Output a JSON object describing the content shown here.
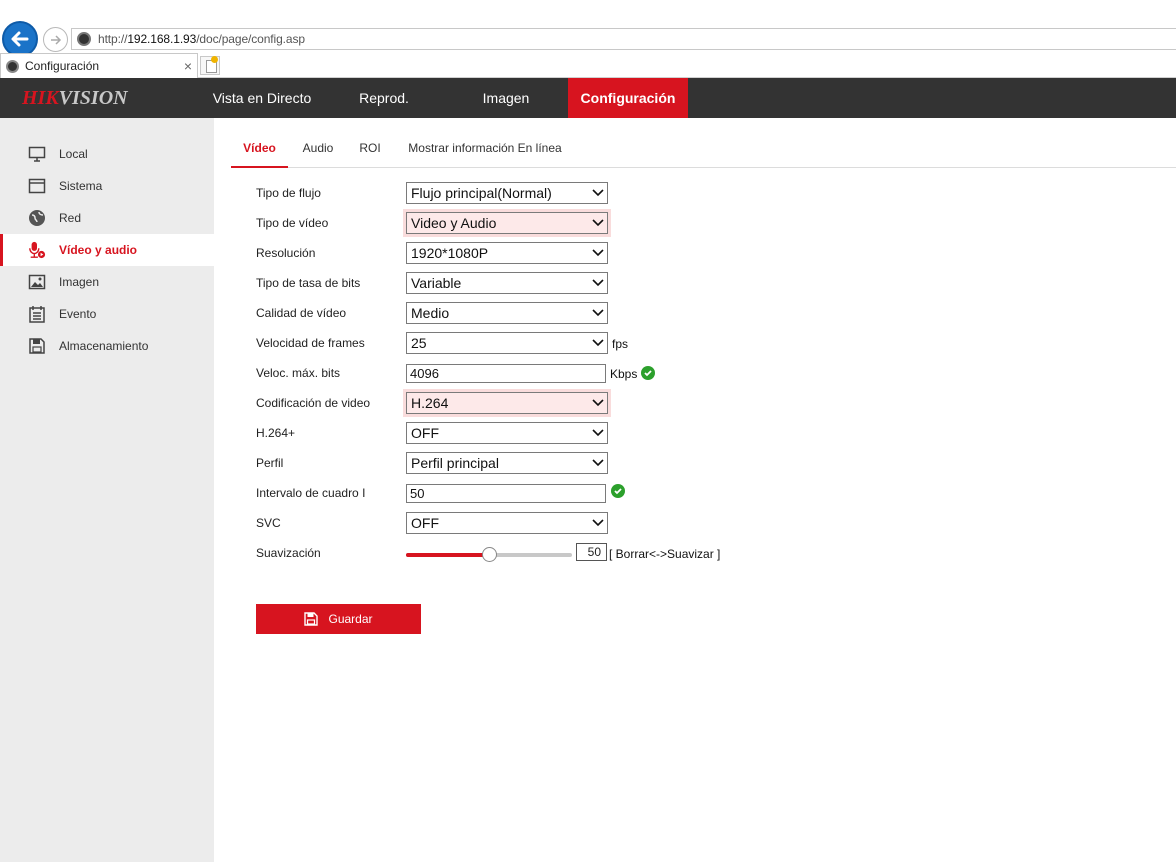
{
  "browser": {
    "url_prefix": "http://",
    "url_host": "192.168.1.93",
    "url_path": "/doc/page/config.asp",
    "tab_title": "Configuración",
    "tab_close": "×"
  },
  "header": {
    "logo_part1": "HIK",
    "logo_part2": "VISION",
    "nav": [
      {
        "label": "Vista en Directo"
      },
      {
        "label": "Reprod."
      },
      {
        "label": "Imagen"
      },
      {
        "label": "Configuración",
        "active": true
      }
    ]
  },
  "sidebar": {
    "items": [
      {
        "label": "Local",
        "icon": "monitor-icon"
      },
      {
        "label": "Sistema",
        "icon": "window-icon"
      },
      {
        "label": "Red",
        "icon": "globe-icon"
      },
      {
        "label": "Vídeo y audio",
        "icon": "microphone-icon",
        "active": true
      },
      {
        "label": "Imagen",
        "icon": "picture-icon"
      },
      {
        "label": "Evento",
        "icon": "calendar-icon"
      },
      {
        "label": "Almacenamiento",
        "icon": "floppy-icon"
      }
    ]
  },
  "tabs": [
    {
      "label": "Vídeo",
      "active": true
    },
    {
      "label": "Audio"
    },
    {
      "label": "ROI"
    },
    {
      "label": "Mostrar información En línea"
    }
  ],
  "form": {
    "stream_type": {
      "label": "Tipo de flujo",
      "value": "Flujo principal(Normal)"
    },
    "video_type": {
      "label": "Tipo de vídeo",
      "value": "Video y Audio"
    },
    "resolution": {
      "label": "Resolución",
      "value": "1920*1080P"
    },
    "bitrate_type": {
      "label": "Tipo de tasa de bits",
      "value": "Variable"
    },
    "video_quality": {
      "label": "Calidad de vídeo",
      "value": "Medio"
    },
    "frame_rate": {
      "label": "Velocidad de frames",
      "value": "25",
      "unit": "fps"
    },
    "max_bitrate": {
      "label": "Veloc. máx. bits",
      "value": "4096",
      "unit": "Kbps"
    },
    "encoding": {
      "label": "Codificación de video",
      "value": "H.264"
    },
    "h264plus": {
      "label": "H.264+",
      "value": "OFF"
    },
    "profile": {
      "label": "Perfil",
      "value": "Perfil principal"
    },
    "i_frame": {
      "label": "Intervalo de cuadro I",
      "value": "50"
    },
    "svc": {
      "label": "SVC",
      "value": "OFF"
    },
    "smoothing": {
      "label": "Suavización",
      "value": "50",
      "hint": "[ Borrar<->Suavizar ]",
      "level_percent": 50
    }
  },
  "save_label": "Guardar",
  "colors": {
    "accent": "#d7141f",
    "header_bg": "#333333",
    "sidebar_bg": "#ececec",
    "ok": "#2ca02c"
  }
}
